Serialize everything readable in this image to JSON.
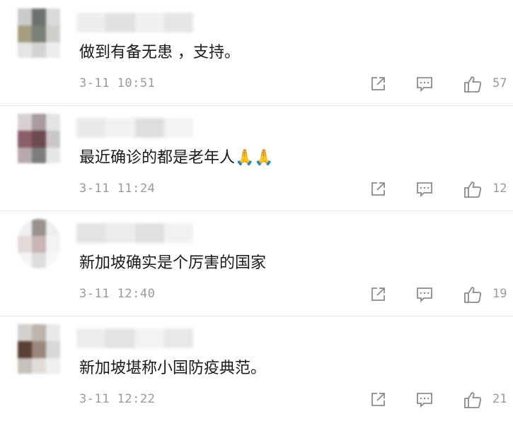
{
  "comments": [
    {
      "text": "做到有备无患 ，支持。",
      "time": "3-11 10:51",
      "likes": "57"
    },
    {
      "text": "最近确诊的都是老年人🙏🙏",
      "time": "3-11 11:24",
      "likes": "12"
    },
    {
      "text": "新加坡确实是个厉害的国家",
      "time": "3-11 12:40",
      "likes": "19"
    },
    {
      "text": "新加坡堪称小国防疫典范。",
      "time": "3-11 12:22",
      "likes": "21"
    }
  ],
  "icons": {
    "share": "share-icon",
    "reply": "comment-icon",
    "like": "thumbs-up-icon"
  },
  "colors": {
    "meta_text": "#9a9a9a",
    "icon": "#8a8a8a",
    "divider": "#e8e8e8"
  }
}
